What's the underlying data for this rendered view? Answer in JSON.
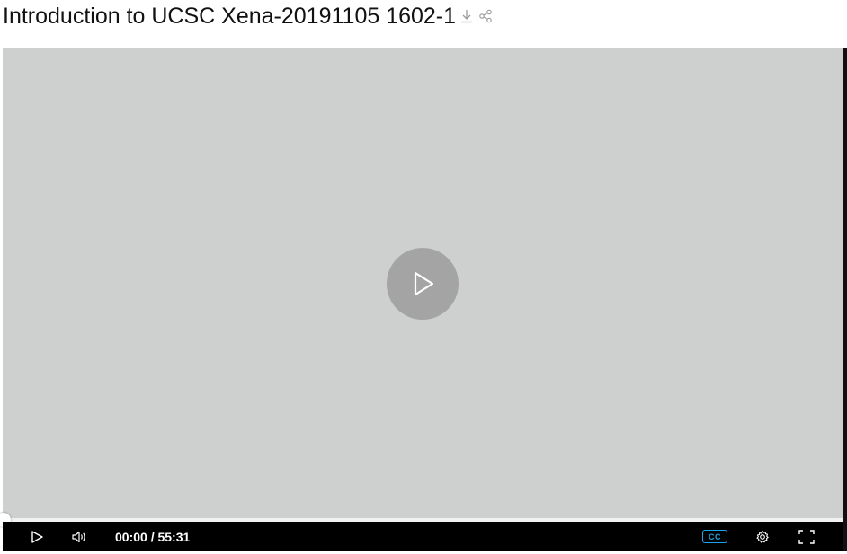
{
  "video": {
    "title": "Introduction to UCSC Xena-20191105 1602-1",
    "current_time": "00:00",
    "separator": " / ",
    "duration": "55:31",
    "progress_fraction": 0.0,
    "cc_label": "CC"
  },
  "icons": {
    "download": "download-icon",
    "share": "share-icon",
    "big_play": "play-icon",
    "play": "play-icon",
    "volume": "volume-icon",
    "cc": "closed-captions-icon",
    "settings": "gear-icon",
    "fullscreen": "fullscreen-icon"
  },
  "colors": {
    "video_background": "#ced0cf",
    "big_play_button": "#a4a4a4",
    "control_bar": "#000000",
    "cc_accent": "#1aa3e8",
    "icon_gray": "#9a9a9a"
  }
}
